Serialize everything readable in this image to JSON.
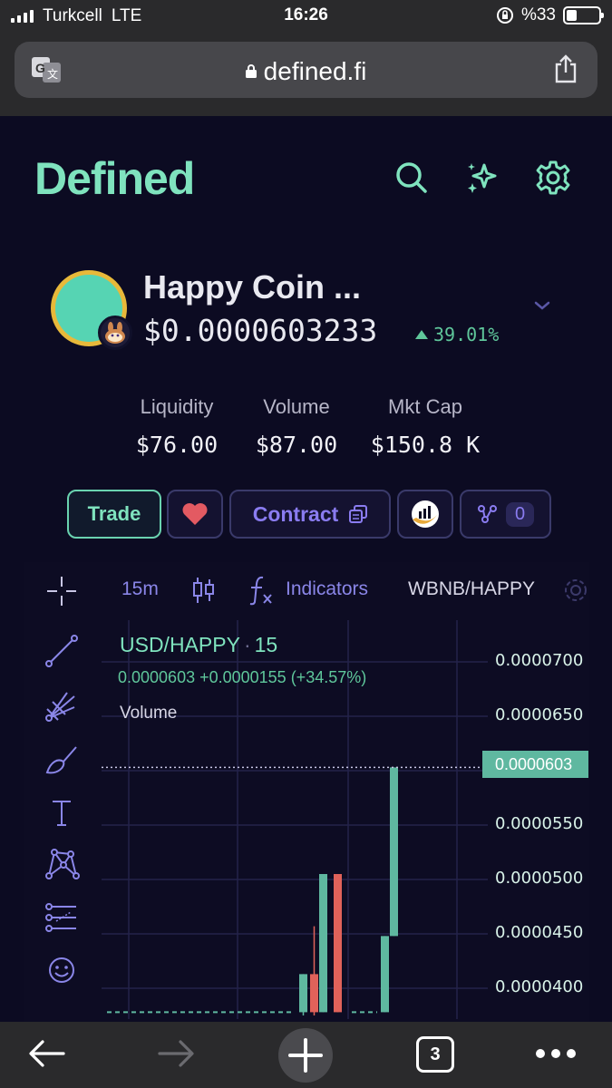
{
  "status_bar": {
    "carrier": "Turkcell",
    "network": "LTE",
    "time": "16:26",
    "battery_percent": "%33"
  },
  "browser": {
    "url": "defined.fi",
    "tab_count": "3"
  },
  "header": {
    "logo": "Defined"
  },
  "token": {
    "name": "Happy Coin ...",
    "price": "$0.0000603233",
    "change": "39.01%",
    "change_direction": "up",
    "avatar_color": "#56d4b3",
    "avatar_ring_color": "#e8b93a"
  },
  "stats": [
    {
      "label": "Liquidity",
      "value": "$76.00"
    },
    {
      "label": "Volume",
      "value": "$87.00"
    },
    {
      "label": "Mkt Cap",
      "value": "$150.8 K"
    }
  ],
  "actions": {
    "trade_label": "Trade",
    "contract_label": "Contract",
    "graph_count": "0"
  },
  "chart_toolbar": {
    "interval": "15m",
    "indicators_label": "Indicators",
    "pair": "WBNB/HAPPY"
  },
  "chart_legend": {
    "symbol": "USD/HAPPY",
    "interval": "15",
    "ohlc_text": "0.0000603  +0.0000155 (+34.57%)",
    "volume_label": "Volume"
  },
  "chart_data": {
    "type": "candlestick",
    "price_axis_ticks": [
      "0.0000700",
      "0.0000650",
      "0.0000603",
      "0.0000550",
      "0.0000500",
      "0.0000450",
      "0.0000400"
    ],
    "last_price": "0.0000603",
    "candles": [
      {
        "open": 3.78e-05,
        "close": 4.13e-05,
        "high": 4.13e-05,
        "low": 3.75e-05,
        "dir": "up"
      },
      {
        "open": 4.13e-05,
        "close": 3.78e-05,
        "high": 4.57e-05,
        "low": 3.75e-05,
        "dir": "down"
      },
      {
        "open": 3.78e-05,
        "close": 5.05e-05,
        "high": 5.05e-05,
        "low": 3.78e-05,
        "dir": "up"
      },
      {
        "open": 5.05e-05,
        "close": 3.78e-05,
        "high": 5.05e-05,
        "low": 3.78e-05,
        "dir": "down"
      },
      {
        "open": 3.78e-05,
        "close": 4.48e-05,
        "high": 4.48e-05,
        "low": 3.78e-05,
        "dir": "up"
      },
      {
        "open": 4.48e-05,
        "close": 6.03e-05,
        "high": 6.03e-05,
        "low": 4.48e-05,
        "dir": "up"
      }
    ],
    "up_color": "#5fb8a0",
    "down_color": "#e0625a",
    "grid": true
  },
  "colors": {
    "accent": "#7fe3be",
    "purple": "#8a7cf0",
    "background": "#0c0b22"
  }
}
